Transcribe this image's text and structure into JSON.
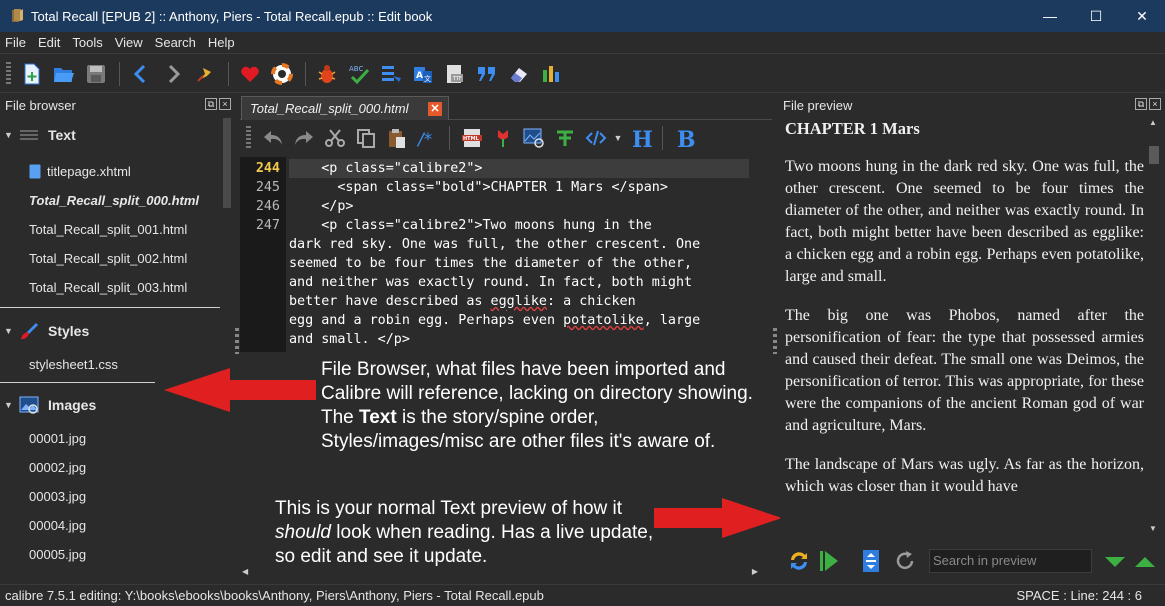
{
  "window": {
    "title": "Total Recall [EPUB 2] :: Anthony, Piers - Total Recall.epub :: Edit book",
    "minimize": "—",
    "maximize": "☐",
    "close": "✕"
  },
  "menu": [
    "File",
    "Edit",
    "Tools",
    "View",
    "Search",
    "Help"
  ],
  "toolbar_icons": [
    "new-file-icon",
    "open-folder-icon",
    "save-icon",
    "back-arrow-icon",
    "forward-arrow-icon",
    "checkpoint-pin-icon",
    "heart-icon",
    "help-lifebuoy-icon",
    "bug-check-icon",
    "spellcheck-icon",
    "reports-icon",
    "translate-icon",
    "fonts-icon",
    "quote-icon",
    "eraser-icon",
    "stats-chart-icon"
  ],
  "file_browser": {
    "header": "File browser",
    "categories": {
      "text": {
        "label": "Text",
        "files": [
          "titlepage.xhtml",
          "Total_Recall_split_000.html",
          "Total_Recall_split_001.html",
          "Total_Recall_split_002.html",
          "Total_Recall_split_003.html"
        ]
      },
      "styles": {
        "label": "Styles",
        "files": [
          "stylesheet1.css"
        ]
      },
      "images": {
        "label": "Images",
        "files": [
          "00001.jpg",
          "00002.jpg",
          "00003.jpg",
          "00004.jpg",
          "00005.jpg"
        ]
      }
    }
  },
  "editor": {
    "tab_label": "Total_Recall_split_000.html",
    "tab_close": "✕",
    "line_numbers": [
      "244",
      "245",
      "246",
      "247"
    ],
    "lines": [
      "    <p class=\"calibre2\">",
      "      <span class=\"bold\">CHAPTER 1 Mars </span>",
      "    </p>",
      "    <p class=\"calibre2\">Two moons hung in the",
      "dark red sky. One was full, the other crescent. One",
      "seemed to be four times the diameter of the other,",
      "and neither was exactly round. In fact, both might",
      "better have described as ",
      "egglike",
      ": a chicken",
      "egg and a robin egg. Perhaps even ",
      "potatolike",
      ", large",
      "and small. </p>"
    ]
  },
  "annotations": {
    "file_browser_note_1": "File Browser, what files have been imported and Calibre will reference, lacking on directory showing. The ",
    "file_browser_note_bold": "Text",
    "file_browser_note_2": " is the story/spine order, Styles/images/misc are other files it's aware of.",
    "preview_note_1": "This is your normal Text preview of how it ",
    "preview_note_em": "should",
    "preview_note_2": " look when reading. Has a live update, so edit and see it update."
  },
  "preview": {
    "header": "File preview",
    "heading": "CHAPTER 1 Mars",
    "paragraphs": [
      "Two moons hung in the dark red sky. One was full, the other crescent. One seemed to be four times the diameter of the other, and neither was exactly round. In fact, both might better have been described as egglike: a chicken egg and a robin egg. Perhaps even potatolike, large and small.",
      "The big one was Phobos, named after the personification of fear: the type that possessed armies and caused their defeat. The small one was Deimos, the personification of terror. This was appropriate, for these were the companions of the ancient Roman god of war and agriculture, Mars.",
      "The landscape of Mars was ugly. As far as the horizon, which was closer than it would have"
    ],
    "search_placeholder": "Search in preview"
  },
  "status": {
    "left": "calibre 7.5.1 editing: Y:\\books\\ebooks\\books\\Anthony, Piers\\Anthony, Piers - Total Recall.epub",
    "right": "SPACE : Line: 244 : 6"
  },
  "colors": {
    "title_bar": "#1c3a5e",
    "background": "#2b2b2b",
    "gutter": "#1a1a1a",
    "current_line_number": "#f2c94c",
    "arrow": "#e02020",
    "tab_close": "#e45a2c"
  }
}
